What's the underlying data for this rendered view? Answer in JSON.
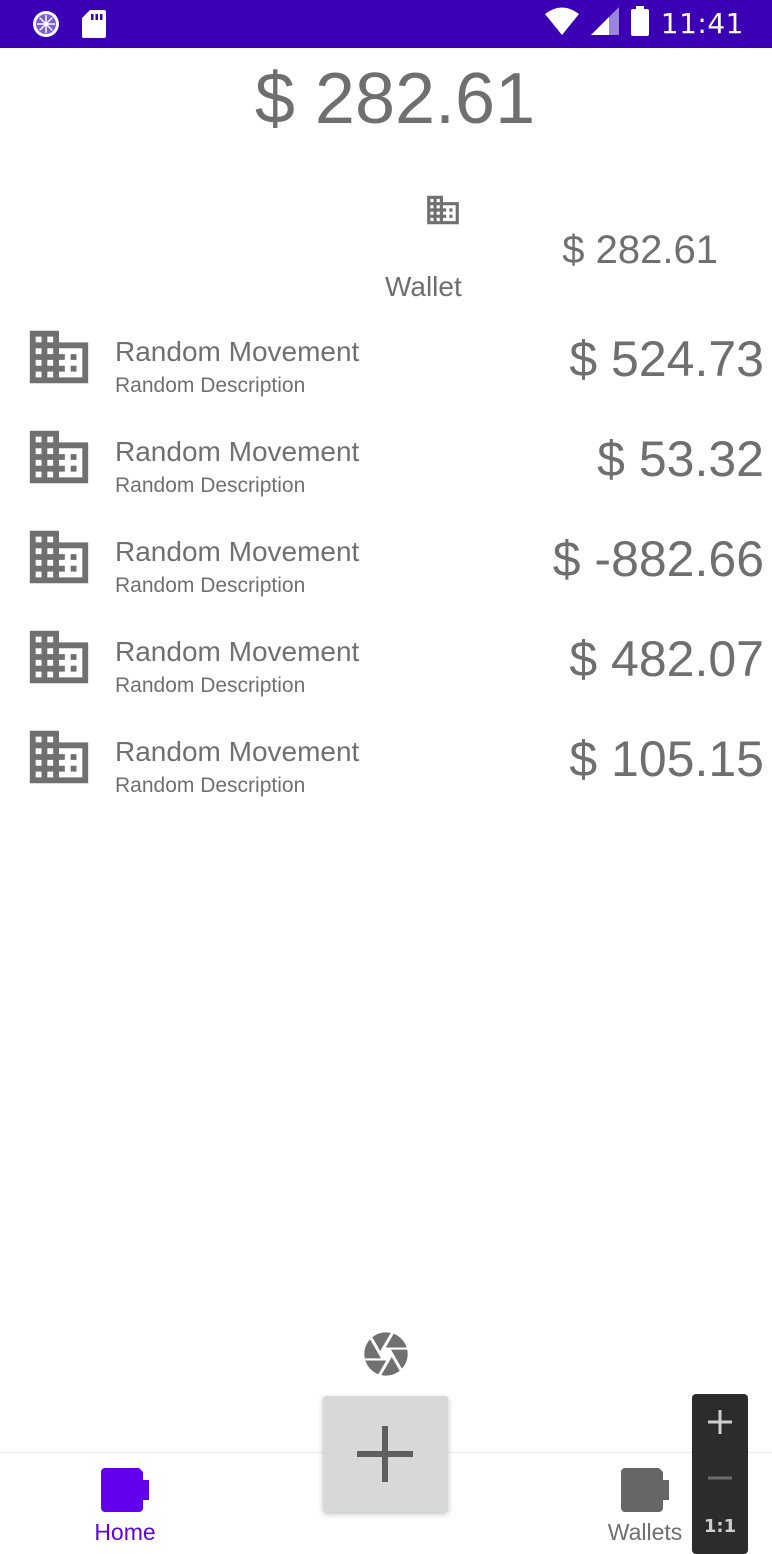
{
  "status_bar": {
    "time": "11:41"
  },
  "total_balance": "$ 282.61",
  "wallet": {
    "name": "Wallet",
    "amount": "$ 282.61"
  },
  "movements": [
    {
      "title": "Random Movement",
      "description": "Random Description",
      "amount": "$ 524.73"
    },
    {
      "title": "Random Movement",
      "description": "Random Description",
      "amount": "$ 53.32"
    },
    {
      "title": "Random Movement",
      "description": "Random Description",
      "amount": "$ -882.66"
    },
    {
      "title": "Random Movement",
      "description": "Random Description",
      "amount": "$ 482.07"
    },
    {
      "title": "Random Movement",
      "description": "Random Description",
      "amount": "$ 105.15"
    }
  ],
  "bottom_nav": {
    "home_label": "Home",
    "wallets_label": "Wallets"
  },
  "zoom_controls": {
    "ratio_label": "1:1"
  },
  "icons": {
    "movement": "business-icon",
    "camera": "camera-shutter-icon",
    "add": "plus-icon"
  },
  "colors": {
    "status_bar": "#3c00b4",
    "accent": "#6200ee",
    "text": "#707070",
    "fab": "#d7d8d8"
  }
}
